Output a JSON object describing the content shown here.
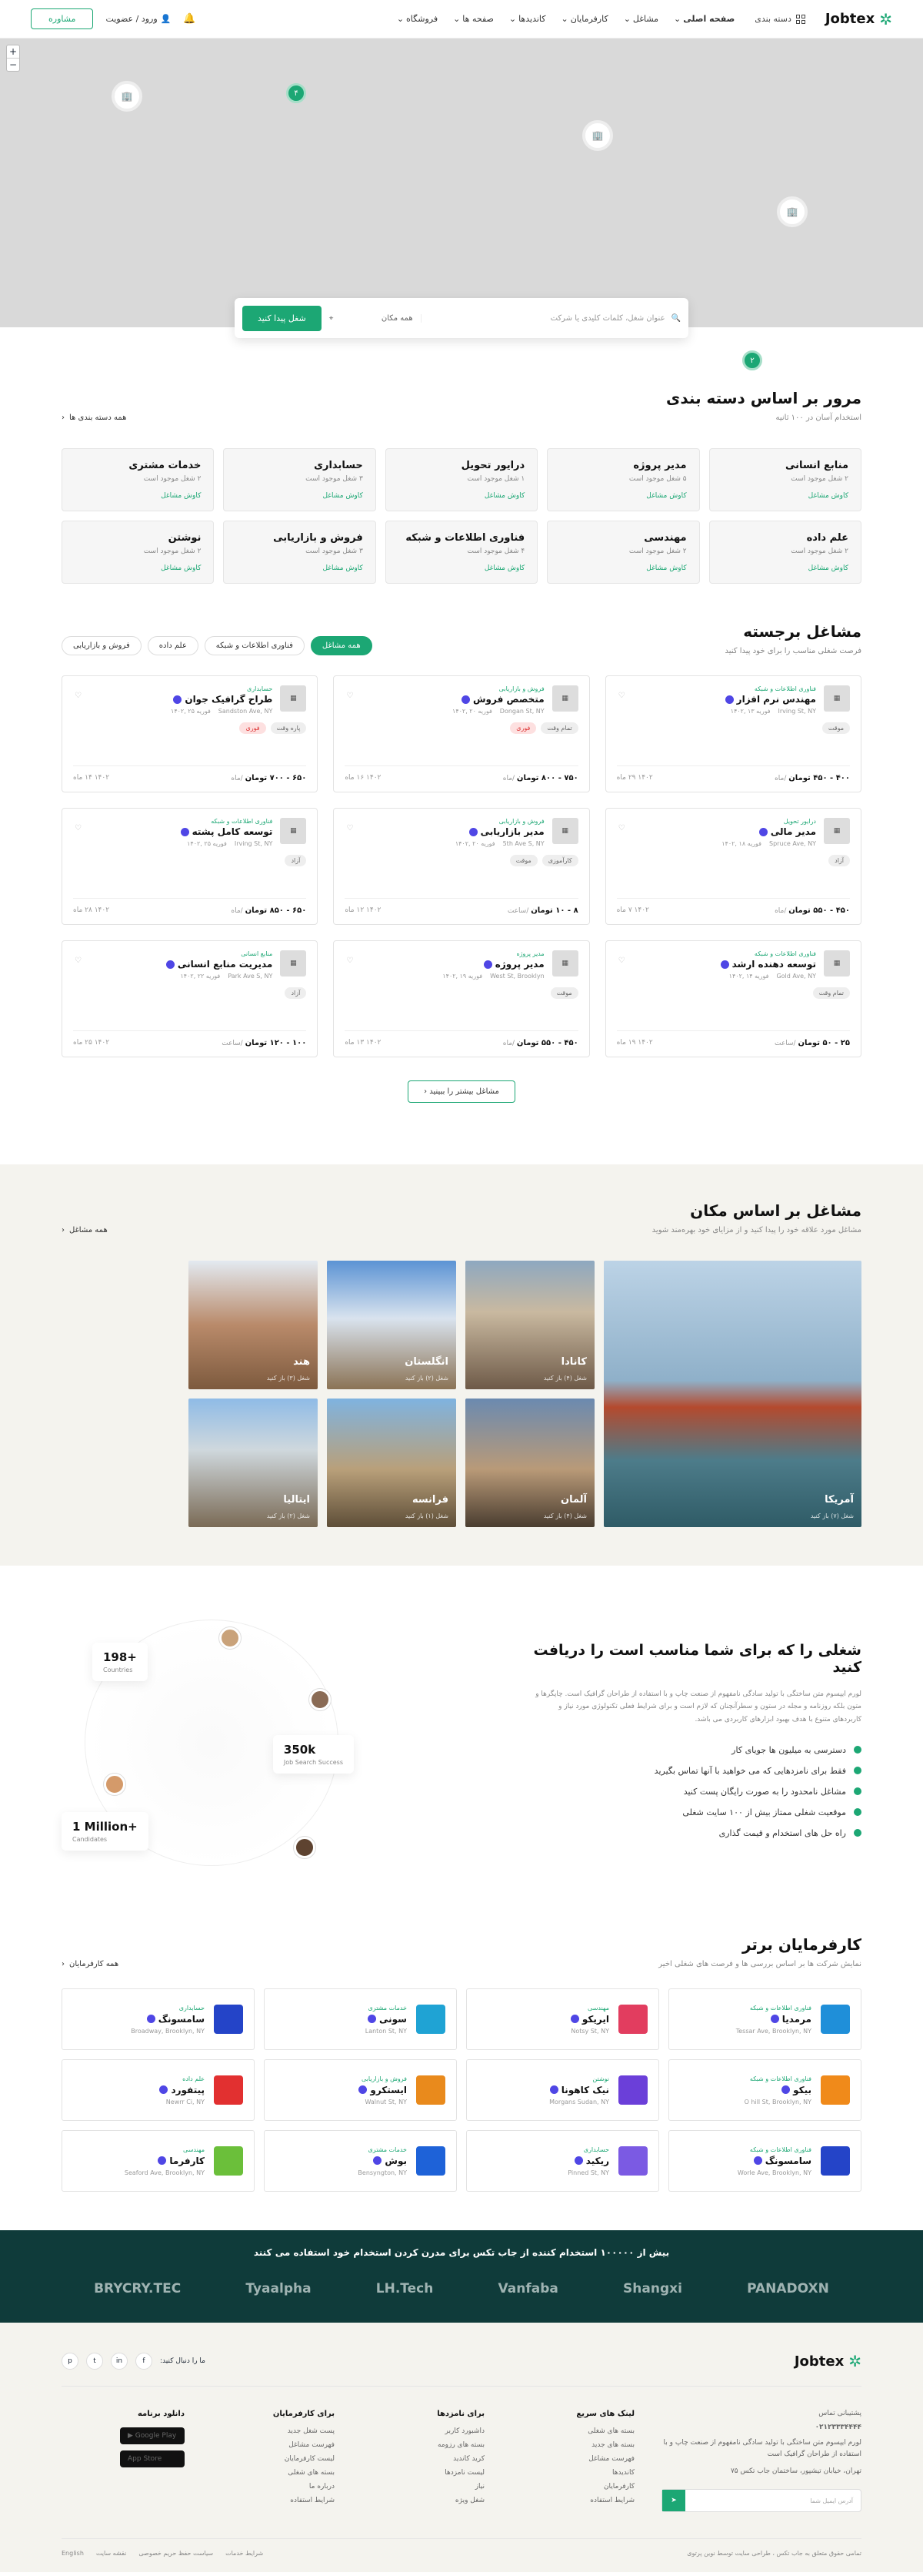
{
  "header": {
    "logo": "Jobtex",
    "categories_btn": "دسته بندی",
    "nav": [
      "صفحه اصلی",
      "مشاغل",
      "کارفرمایان",
      "کاندیدها",
      "صفحه ها",
      "فروشگاه"
    ],
    "login": "ورود / عضویت",
    "consult_btn": "مشاوره"
  },
  "map": {
    "cluster_labels": [
      "۴",
      "۲"
    ],
    "zoom_in": "+",
    "zoom_out": "−"
  },
  "search": {
    "keyword_placeholder": "عنوان شغل، کلمات کلیدی یا شرکت",
    "location": "همه مکان",
    "button": "شغل پیدا کنید"
  },
  "categories": {
    "title": "مرور بر اساس دسته بندی",
    "subtitle": "استخدام آسان در ۱۰۰ ثانیه",
    "view_all": "همه دسته بندی ها",
    "items": [
      {
        "name": "منابع انسانی",
        "count": "۲ شغل موجود است",
        "link": "کاوش مشاغل"
      },
      {
        "name": "مدیر پروژه",
        "count": "۵ شغل موجود است",
        "link": "کاوش مشاغل"
      },
      {
        "name": "درایور تحویل",
        "count": "۱ شغل موجود است",
        "link": "کاوش مشاغل"
      },
      {
        "name": "حسابداری",
        "count": "۳ شغل موجود است",
        "link": "کاوش مشاغل"
      },
      {
        "name": "خدمات مشتری",
        "count": "۲ شغل موجود است",
        "link": "کاوش مشاغل"
      },
      {
        "name": "علم داده",
        "count": "۲ شغل موجود است",
        "link": "کاوش مشاغل"
      },
      {
        "name": "مهندسی",
        "count": "۲ شغل موجود است",
        "link": "کاوش مشاغل"
      },
      {
        "name": "فناوری اطلاعات و شبکه",
        "count": "۴ شغل موجود است",
        "link": "کاوش مشاغل"
      },
      {
        "name": "فروش و بازاریابی",
        "count": "۳ شغل موجود است",
        "link": "کاوش مشاغل"
      },
      {
        "name": "نوشتن",
        "count": "۲ شغل موجود است",
        "link": "کاوش مشاغل"
      }
    ]
  },
  "jobs": {
    "title": "مشاغل برجسته",
    "subtitle": "فرصت شغلی مناسب را برای خود پیدا کنید",
    "filters": [
      "همه مشاغل",
      "فناوری اطلاعات و شبکه",
      "علم داده",
      "فروش و بازاریابی"
    ],
    "more_btn": "مشاغل بیشتر را ببینید",
    "items": [
      {
        "category": "فناوری اطلاعات و شبکه",
        "title": "مهندس نرم افزار",
        "location": "Irving St, NY",
        "date": "فوریه ۱۳ ,۱۴۰۲",
        "tags": [
          "موقت"
        ],
        "salary": "۴۰۰ - ۴۵۰ تومان",
        "per": "/ماه",
        "time": "۱۴۰۲ ۲۹ ماه"
      },
      {
        "category": "فروش و بازاریابی",
        "title": "متخصص فروش",
        "location": "Dongan St, NY",
        "date": "فوریه ۲۰ ,۱۴۰۲",
        "tags": [
          "تمام وقت",
          "فوری"
        ],
        "salary": "۷۵۰ - ۸۰۰ تومان",
        "per": "/ماه",
        "time": "۱۴۰۲ ۱۶ ماه"
      },
      {
        "category": "حسابداری",
        "title": "طراح گرافیک جوان",
        "location": "Sandston Ave, NY",
        "date": "فوریه ۲۵ ,۱۴۰۲",
        "tags": [
          "پاره وقت",
          "فوری"
        ],
        "salary": "۶۵۰ - ۷۰۰ تومان",
        "per": "/ماه",
        "time": "۱۴۰۲ ۱۴ ماه"
      },
      {
        "category": "درایور تحویل",
        "title": "مدیر مالی",
        "location": "Spruce Ave, NY",
        "date": "فوریه ۱۸ ,۱۴۰۲",
        "tags": [
          "آزاد"
        ],
        "salary": "۴۵۰ - ۵۵۰ تومان",
        "per": "/ماه",
        "time": "۱۴۰۲ ۷ ماه"
      },
      {
        "category": "فروش و بازاریابی",
        "title": "مدیر بازاریابی",
        "location": "5th Ave S, NY",
        "date": "فوریه ۲۰ ,۱۴۰۲",
        "tags": [
          "کارآموزی",
          "موقت"
        ],
        "salary": "۸ - ۱۰ تومان",
        "per": "/ساعت",
        "time": "۱۴۰۲ ۱۲ ماه"
      },
      {
        "category": "فناوری اطلاعات و شبکه",
        "title": "توسعه کامل پشته",
        "location": "Irving St, NY",
        "date": "فوریه ۲۵ ,۱۴۰۲",
        "tags": [
          "آزاد"
        ],
        "salary": "۶۵۰ - ۸۵۰ تومان",
        "per": "/ماه",
        "time": "۱۴۰۲ ۲۸ ماه"
      },
      {
        "category": "فناوری اطلاعات و شبکه",
        "title": "توسعه دهنده ارشد",
        "location": "Gold Ave, NY",
        "date": "فوریه ۱۴ ,۱۴۰۲",
        "tags": [
          "تمام وقت"
        ],
        "salary": "۲۵ - ۵۰ تومان",
        "per": "/ساعت",
        "time": "۱۴۰۲ ۱۹ ماه"
      },
      {
        "category": "مدیر پروژه",
        "title": "مدیر پروژه",
        "location": "West St, Brooklyn",
        "date": "فوریه ۱۹ ,۱۴۰۲",
        "tags": [
          "موقت"
        ],
        "salary": "۴۵۰ - ۵۵۰ تومان",
        "per": "/ماه",
        "time": "۱۴۰۲ ۱۳ ماه"
      },
      {
        "category": "منابع انسانی",
        "title": "مدیریت منابع انسانی",
        "location": "Park Ave S, NY",
        "date": "فوریه ۲۲ ,۱۴۰۲",
        "tags": [
          "آزاد"
        ],
        "salary": "۱۰۰ - ۱۲۰ تومان",
        "per": "/ساعت",
        "time": "۱۴۰۲ ۲۵ ماه"
      }
    ]
  },
  "locations": {
    "title": "مشاغل بر اساس مکان",
    "subtitle": "مشاغل مورد علاقه خود را پیدا کنید و از مزایای خود بهره‌مند شوید",
    "view_all": "همه مشاغل",
    "items": [
      {
        "name": "آمریکا",
        "count": "شغل (۷) باز کنید"
      },
      {
        "name": "کانادا",
        "count": "شغل (۴) باز کنید"
      },
      {
        "name": "انگلستان",
        "count": "شغل (۲) باز کنید"
      },
      {
        "name": "هند",
        "count": "شغل (۳) باز کنید"
      },
      {
        "name": "آلمان",
        "count": "شغل (۴) باز کنید"
      },
      {
        "name": "فرانسه",
        "count": "شغل (۱) باز کنید"
      },
      {
        "name": "ایتالیا",
        "count": "شغل (۲) باز کنید"
      }
    ]
  },
  "promo": {
    "title": "شغلی را که برای شما مناسب است را دریافت کنید",
    "desc": "لورم ایپسوم متن ساختگی با تولید سادگی نامفهوم از صنعت چاپ و با استفاده از طراحان گرافیک است. چاپگرها و متون بلکه روزنامه و مجله در ستون و سطرآنچنان که لازم است و برای شرایط فعلی تکنولوژی مورد نیاز و کاربردهای متنوع با هدف بهبود ابزارهای کاربردی می باشد.",
    "points": [
      "دسترسی به میلیون ها جویای کار",
      "فقط برای نامزدهایی که می خواهید با آنها تماس بگیرید",
      "مشاغل نامحدود را به صورت رایگان پست کنید",
      "موقعیت شغلی ممتاز  بیش از ۱۰۰ سایت شغلی",
      "راه حل های استخدام و قیمت گذاری"
    ],
    "stats": [
      {
        "value": "198+",
        "label": "Countries"
      },
      {
        "value": "350k",
        "label": "Job Search Success"
      },
      {
        "value": "1 Million+",
        "label": "Candidates"
      }
    ]
  },
  "employers": {
    "title": "کارفرمایان برتر",
    "subtitle": "نمایش شرکت ها بر اساس بررسی ها و فرصت های شغلی اخیر",
    "view_all": "همه کارفرمایان",
    "items": [
      {
        "category": "فناوری اطلاعات و شبکه",
        "name": "مرمدیا",
        "address": "Tessar Ave, Brooklyn, NY",
        "color": "#1f8fd9"
      },
      {
        "category": "مهندسی",
        "name": "ایریکو",
        "address": "Notsy St, NY",
        "color": "#e23d5f"
      },
      {
        "category": "خدمات مشتری",
        "name": "سونی",
        "address": "Lanton St, NY",
        "color": "#1fa3d4"
      },
      {
        "category": "حسابداری",
        "name": "سامسونگ",
        "address": "Broadway, Brooklyn, NY",
        "color": "#2444c8"
      },
      {
        "category": "فناوری اطلاعات و شبکه",
        "name": "بیکو",
        "address": "O hill St, Brooklyn, NY",
        "color": "#f08a1a"
      },
      {
        "category": "نوشتن",
        "name": "نیک کاهونا",
        "address": "Morgans Sudan, NY",
        "color": "#6b3fd9"
      },
      {
        "category": "فروش و بازاریابی",
        "name": "ایستکرو",
        "address": "Walnut St, NY",
        "color": "#e98a1c"
      },
      {
        "category": "علم داده",
        "name": "پیتفورد",
        "address": "Newrr Ci, NY",
        "color": "#e23030"
      },
      {
        "category": "فناوری اطلاعات و شبکه",
        "name": "سامسونگ",
        "address": "Worle Ave, Brooklyn, NY",
        "color": "#2444c8"
      },
      {
        "category": "حسابداری",
        "name": "ریکید",
        "address": "Pinned St, NY",
        "color": "#7b5ae3"
      },
      {
        "category": "خدمات مشتری",
        "name": "بوش",
        "address": "Bensyngton, NY",
        "color": "#1e62d8"
      },
      {
        "category": "مهندسی",
        "name": "کارفرما",
        "address": "Seaford Ave, Brooklyn, NY",
        "color": "#6bbf3a"
      }
    ]
  },
  "partners": {
    "title": "بیش از ۱۰۰۰۰۰ استخدام کننده از جاب تکس برای مدرن کردن استخدام خود استفاده می کنند",
    "brands": [
      "BRYCRY.TEC",
      "Tyaalpha",
      "LH.Tech",
      "Vanfaba",
      "Shangxi",
      "PANADOXN"
    ]
  },
  "footer": {
    "logo": "Jobtex",
    "follow": "ما را دنبال کنید:",
    "social": [
      "f",
      "in",
      "t",
      "p"
    ],
    "contact_label": "پشتیبانی تماس",
    "phone": "۰۲۱۲۳۳۳۴۴۴۴",
    "contact_desc": "لورم ایپسوم متن ساختگی با تولید سادگی نامفهوم از صنعت چاپ و با استفاده از طراحان گرافیک است",
    "address": "تهران، خیابان تیشپور، ساختمان جاب تکس ۷۵",
    "newsletter_placeholder": "آدرس ایمیل شما",
    "newsletter_btn": "➤",
    "cols": [
      {
        "title": "لینک های سریع",
        "links": [
          "بسته های شغلی",
          "بسته های جدید",
          "فهرست مشاغل",
          "کاندیدها",
          "کارفرمایان",
          "شرایط استفاده"
        ]
      },
      {
        "title": "برای نامزدها",
        "links": [
          "داشبورد کاربر",
          "بسته های رزومه",
          "کرید کاندید",
          "لیست نامزدها",
          "نیاز",
          "شغل ویژه"
        ]
      },
      {
        "title": "برای کارفرمایان",
        "links": [
          "پست شغل جدید",
          "فهرست مشاغل",
          "لیست کارفرمایان",
          "بسته های شغلی",
          "درباره ما",
          "شرایط استفاده"
        ]
      },
      {
        "title": "دانلود برنامه",
        "links": [
          "Google Play",
          "App Store"
        ]
      }
    ],
    "copyright": "تمامی حقوق متعلق به جاب تکس ، طراحی سایت توسط نوین پرتوی",
    "bottom_links": [
      "شرایط خدمات",
      "سیاست حفظ حریم خصوصی",
      "نقشه سایت"
    ],
    "lang": "English"
  }
}
